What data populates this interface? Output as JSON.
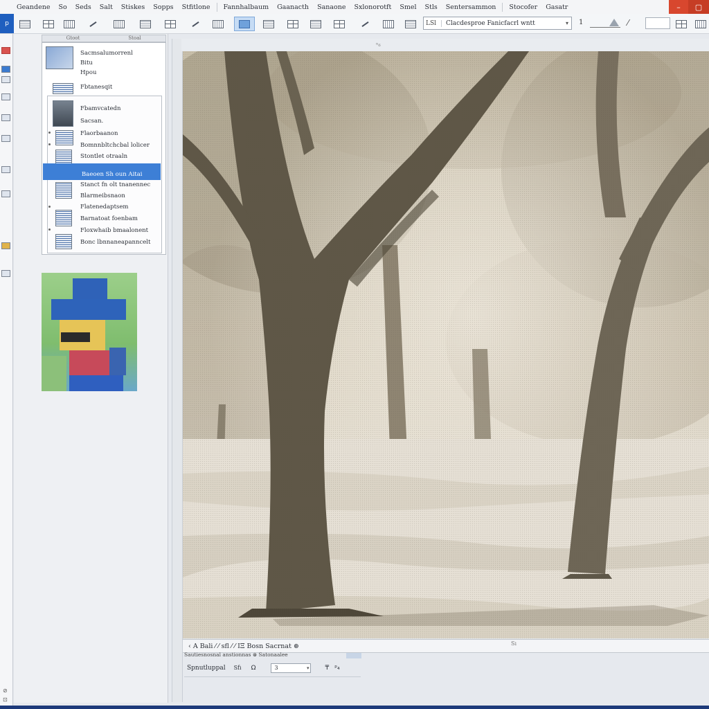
{
  "menu": {
    "items": [
      "Geandene",
      "So",
      "Seds",
      "Salt",
      "Stiskes",
      "Sopps",
      "Stfitlone",
      "Fannhalbaum",
      "Gaanacth",
      "Sanaone",
      "Sxlonorotft",
      "Smel",
      "Stls",
      "Sentersammon",
      "Stocofer",
      "Gasatr"
    ],
    "window_buttons": [
      "–",
      "▢"
    ],
    "accent_close": "#d8472e"
  },
  "toolbar": {
    "app_label": "p",
    "font_label": "LSl",
    "font_value": "Clacdesproe Fanicfacrl wntt",
    "size_value": "1"
  },
  "layers": {
    "header_tabs": [
      "Gtoot",
      "Stoal"
    ],
    "rows": [
      {
        "label": "Sacmsalumorrenl"
      },
      {
        "label": "Bitu"
      },
      {
        "label": "Hpou"
      },
      {
        "label": "Fbtanesqit"
      },
      {
        "label": "Fbamvcatedn"
      },
      {
        "label": "Sacsan."
      },
      {
        "label": "Flaorbaanon"
      },
      {
        "label": "Bomnnbltchcbal lolicer"
      },
      {
        "label": "Stontlet otraaln"
      },
      {
        "label": "Baeoen Sh oun Aitai"
      },
      {
        "label": "Stanct fn olt tnanennec"
      },
      {
        "label": "Blarmeibsnaon"
      },
      {
        "label": "Flatenedaptsem"
      },
      {
        "label": "Barnatoat foenbam"
      },
      {
        "label": "Floxwhaib bmaalonent"
      },
      {
        "label": "Bonc lbnnaneapanncelt"
      }
    ],
    "selected_color": "#3d7fd6"
  },
  "statusbar": {
    "text": "‹ A  Bali ⁄ ⁄  sfl ⁄ ⁄ ΙΞ  Bosn Sacrnat ⊛",
    "mark": "Sı"
  },
  "properties": {
    "line": "Sautiesnosnal anstionnas  ⊛ Satonaalee",
    "name": "Spnutluppal",
    "swatch": "Sfı",
    "zoom_icon": "Ω",
    "field_value": "3",
    "tools": [
      "₸",
      "ᵖ₄"
    ]
  },
  "canvas": {
    "mark": "ⁿ₆"
  },
  "colors": {
    "titlebar_blue": "#1f5fbf",
    "taskbar": "#1d3a7a",
    "canvas_sepia": "#cfc6b3"
  }
}
